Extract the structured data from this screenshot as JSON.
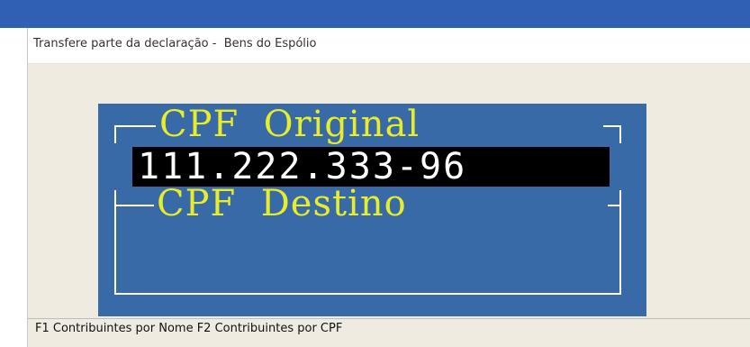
{
  "window": {
    "title": "Transfere parte da declaração -  Bens do Espólio"
  },
  "console": {
    "original_label": "CPF  Original",
    "cpf_value": "111.222.333-96",
    "destino_label": "CPF  Destino"
  },
  "status_bar": {
    "text": "F1 Contribuintes por Nome F2 Contribuintes por CPF"
  },
  "colors": {
    "console_background": "#376aa6",
    "label_yellow": "#e8ec2a",
    "field_background": "#000000",
    "window_background": "#f0ebe1",
    "frame_blue": "#2f60b2"
  }
}
